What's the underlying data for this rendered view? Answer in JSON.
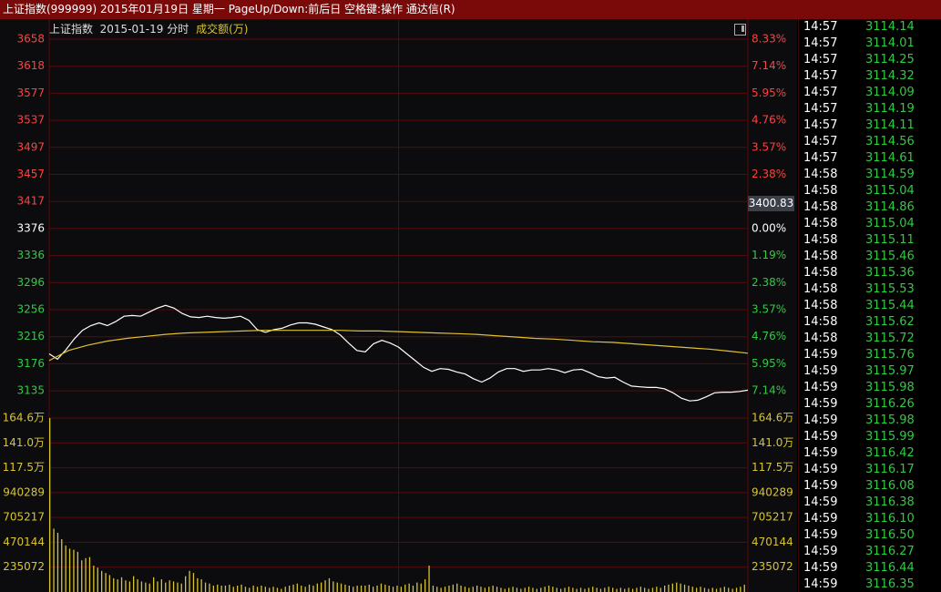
{
  "titlebar": {
    "text": "上证指数(999999) 2015年01月19日 星期一 PageUp/Down:前后日 空格键:操作 通达信(R)"
  },
  "chart_header": {
    "index_name": "上证指数",
    "date": "2015-01-19",
    "mode": "分时",
    "volume_label": "成交额(万)"
  },
  "current_price_label": "3400.83",
  "colors": {
    "up": "#ff4040",
    "down": "#2ecc40",
    "flat": "#ffffff",
    "price_line": "#ffffff",
    "avg_line": "#e0c030",
    "volume": "#d8c430",
    "grid": "#5a0a0a"
  },
  "chart_data": [
    {
      "type": "line",
      "title": "",
      "ylim": [
        3135,
        3658
      ],
      "y_ticks_left": [
        "3658",
        "3618",
        "3577",
        "3537",
        "3497",
        "3457",
        "3417",
        "3376",
        "3336",
        "3296",
        "3256",
        "3216",
        "3176",
        "3135"
      ],
      "y_ticks_right": [
        "8.33%",
        "7.14%",
        "5.95%",
        "4.76%",
        "3.57%",
        "2.38%",
        "1.19%",
        "0.00%",
        "1.19%",
        "2.38%",
        "3.57%",
        "4.76%",
        "5.95%",
        "7.14%"
      ],
      "tick_direction": [
        "up",
        "up",
        "up",
        "up",
        "up",
        "up",
        "up",
        "flat",
        "down",
        "down",
        "down",
        "down",
        "down",
        "down"
      ],
      "series": [
        {
          "values": [
            3190,
            3182,
            3196,
            3212,
            3225,
            3232,
            3236,
            3232,
            3238,
            3246,
            3247,
            3246,
            3252,
            3258,
            3262,
            3258,
            3250,
            3245,
            3244,
            3246,
            3244,
            3243,
            3244,
            3246,
            3240,
            3226,
            3222,
            3226,
            3228,
            3233,
            3236,
            3236,
            3234,
            3230,
            3226,
            3218,
            3206,
            3195,
            3193,
            3205,
            3210,
            3206,
            3200,
            3190,
            3180,
            3170,
            3164,
            3168,
            3167,
            3163,
            3160,
            3153,
            3148,
            3154,
            3163,
            3168,
            3168,
            3164,
            3166,
            3166,
            3168,
            3166,
            3162,
            3166,
            3167,
            3162,
            3156,
            3154,
            3155,
            3148,
            3142,
            3141,
            3140,
            3140,
            3138,
            3132,
            3124,
            3120,
            3121,
            3126,
            3132,
            3133,
            3133,
            3134,
            3136
          ]
        },
        {
          "values": [
            3180,
            3195,
            3203,
            3209,
            3213,
            3216,
            3219,
            3221,
            3222,
            3223,
            3224,
            3225,
            3225,
            3225,
            3225,
            3225,
            3224,
            3224,
            3223,
            3222,
            3221,
            3220,
            3219,
            3217,
            3215,
            3213,
            3212,
            3210,
            3208,
            3207,
            3205,
            3203,
            3201,
            3199,
            3197,
            3194,
            3191
          ]
        }
      ]
    },
    {
      "type": "bar",
      "title": "",
      "ylim": [
        0,
        1646000
      ],
      "y_ticks": [
        "164.6万",
        "141.0万",
        "117.5万",
        "940289",
        "705217",
        "470144",
        "235072"
      ],
      "values": [
        1646000,
        600000,
        560000,
        500000,
        440000,
        410000,
        400000,
        380000,
        300000,
        320000,
        330000,
        250000,
        230000,
        200000,
        180000,
        160000,
        130000,
        120000,
        140000,
        110000,
        100000,
        150000,
        120000,
        100000,
        90000,
        80000,
        140000,
        100000,
        120000,
        90000,
        110000,
        100000,
        90000,
        80000,
        150000,
        200000,
        180000,
        130000,
        120000,
        90000,
        80000,
        60000,
        70000,
        60000,
        60000,
        70000,
        50000,
        60000,
        70000,
        50000,
        40000,
        60000,
        50000,
        60000,
        50000,
        40000,
        50000,
        40000,
        30000,
        50000,
        60000,
        70000,
        80000,
        60000,
        50000,
        70000,
        60000,
        80000,
        90000,
        110000,
        130000,
        100000,
        90000,
        80000,
        70000,
        60000,
        50000,
        60000,
        60000,
        60000,
        70000,
        50000,
        60000,
        80000,
        70000,
        60000,
        50000,
        60000,
        50000,
        70000,
        80000,
        60000,
        90000,
        80000,
        120000,
        250000,
        60000,
        50000,
        40000,
        50000,
        60000,
        70000,
        80000,
        60000,
        50000,
        40000,
        50000,
        60000,
        50000,
        40000,
        50000,
        60000,
        50000,
        40000,
        30000,
        40000,
        50000,
        40000,
        30000,
        40000,
        50000,
        40000,
        30000,
        40000,
        50000,
        60000,
        50000,
        40000,
        30000,
        40000,
        50000,
        40000,
        30000,
        40000,
        30000,
        40000,
        50000,
        40000,
        30000,
        40000,
        50000,
        40000,
        30000,
        40000,
        30000,
        40000,
        30000,
        40000,
        50000,
        40000,
        30000,
        40000,
        50000,
        40000,
        60000,
        70000,
        80000,
        90000,
        80000,
        70000,
        60000,
        50000,
        40000,
        50000,
        40000,
        30000,
        40000,
        30000,
        40000,
        50000,
        40000,
        30000,
        40000,
        50000,
        70000
      ]
    }
  ],
  "ticks": [
    {
      "time": "14:57",
      "price": "3114.14"
    },
    {
      "time": "14:57",
      "price": "3114.01"
    },
    {
      "time": "14:57",
      "price": "3114.25"
    },
    {
      "time": "14:57",
      "price": "3114.32"
    },
    {
      "time": "14:57",
      "price": "3114.09"
    },
    {
      "time": "14:57",
      "price": "3114.19"
    },
    {
      "time": "14:57",
      "price": "3114.11"
    },
    {
      "time": "14:57",
      "price": "3114.56"
    },
    {
      "time": "14:57",
      "price": "3114.61"
    },
    {
      "time": "14:58",
      "price": "3114.59"
    },
    {
      "time": "14:58",
      "price": "3115.04"
    },
    {
      "time": "14:58",
      "price": "3114.86"
    },
    {
      "time": "14:58",
      "price": "3115.04"
    },
    {
      "time": "14:58",
      "price": "3115.11"
    },
    {
      "time": "14:58",
      "price": "3115.46"
    },
    {
      "time": "14:58",
      "price": "3115.36"
    },
    {
      "time": "14:58",
      "price": "3115.53"
    },
    {
      "time": "14:58",
      "price": "3115.44"
    },
    {
      "time": "14:58",
      "price": "3115.62"
    },
    {
      "time": "14:58",
      "price": "3115.72"
    },
    {
      "time": "14:59",
      "price": "3115.76"
    },
    {
      "time": "14:59",
      "price": "3115.97"
    },
    {
      "time": "14:59",
      "price": "3115.98"
    },
    {
      "time": "14:59",
      "price": "3116.26"
    },
    {
      "time": "14:59",
      "price": "3115.98"
    },
    {
      "time": "14:59",
      "price": "3115.99"
    },
    {
      "time": "14:59",
      "price": "3116.42"
    },
    {
      "time": "14:59",
      "price": "3116.17"
    },
    {
      "time": "14:59",
      "price": "3116.08"
    },
    {
      "time": "14:59",
      "price": "3116.38"
    },
    {
      "time": "14:59",
      "price": "3116.10"
    },
    {
      "time": "14:59",
      "price": "3116.50"
    },
    {
      "time": "14:59",
      "price": "3116.27"
    },
    {
      "time": "14:59",
      "price": "3116.44"
    },
    {
      "time": "14:59",
      "price": "3116.35"
    }
  ]
}
